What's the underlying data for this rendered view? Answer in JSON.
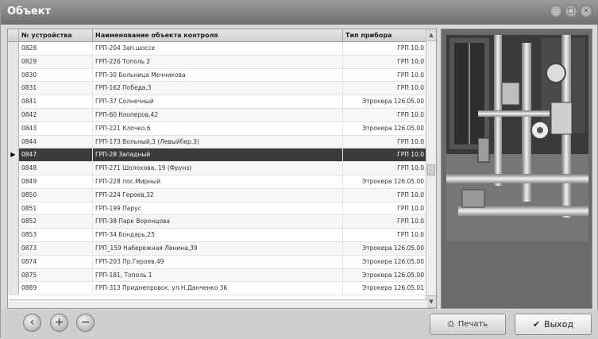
{
  "window": {
    "title": "Объект"
  },
  "table": {
    "headers": [
      "№ устройства",
      "Наименование объекта контроля",
      "Тип прибора"
    ],
    "rows": [
      [
        "0828",
        "ГРП-204 Зап.шоссе",
        "ГРП 10.0"
      ],
      [
        "0829",
        "ГРП-226 Тополь 2",
        "ГРП 10.0"
      ],
      [
        "0830",
        "ГРП-30 Больница Мечникова",
        "ГРП 10.0"
      ],
      [
        "0831",
        "ГРП-162 Победа,3",
        "ГРП 10.0"
      ],
      [
        "0841",
        "ГРП-37 Солнечный",
        "Этрокера 126.05.00"
      ],
      [
        "0842",
        "ГРП-60 Кооперов,42",
        "ГРП 10.0"
      ],
      [
        "0843",
        "ГРП-221 Клочко,6",
        "Этрокера 126.05.00"
      ],
      [
        "0844",
        "ГРП-173 Вольный,3 (Левыйбер.3)",
        "ГРП 10.0"
      ],
      [
        "0847",
        "ГРП-28 Западный",
        "ГРП 10.0"
      ],
      [
        "0848",
        "ГРП-271 Шолохова, 19 (Фрунз)",
        "ГРП 10.0"
      ],
      [
        "0849",
        "ГРП-228 пос.Мирный",
        "Этрокера 126.05.00"
      ],
      [
        "0850",
        "ГРП-224 Героев,32",
        "ГРП 10.0"
      ],
      [
        "0851",
        "ГРП-199 Парус",
        "ГРП 10.0"
      ],
      [
        "0852",
        "ГРП-38 Парк Воронцова",
        "ГРП 10.0"
      ],
      [
        "0853",
        "ГРП-34 Бондарь,25",
        "ГРП 10.0"
      ],
      [
        "0873",
        "ГРП_159 Набережная Ленина,39",
        "Этрокера 126.05.00"
      ],
      [
        "0874",
        "ГРП-203 Пр.Героев,49",
        "Этрокера 126.05.00"
      ],
      [
        "0875",
        "ГРП-181, Тополь 1",
        "Этрокера 126.05.00"
      ],
      [
        "0889",
        "ГРП-313 Приднепровск. ул.Н.Данченко 36",
        "Этрокера 126.05.01"
      ]
    ],
    "selected_index": 8
  },
  "icons": {
    "close": "close-icon",
    "add": "plus-icon",
    "remove": "minus-icon",
    "left": "back-icon",
    "print": "printer-icon",
    "ok": "check-icon"
  },
  "footer": {
    "print_label": "Печать",
    "exit_label": "Выход"
  },
  "colors": {
    "selected_row": "#3c3c3c",
    "titlebar": "#7a7a7a"
  }
}
